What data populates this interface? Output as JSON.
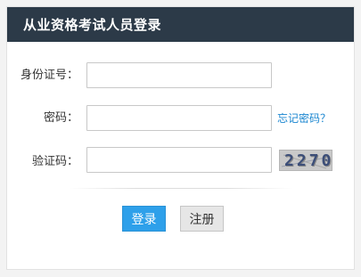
{
  "header": {
    "title": "从业资格考试人员登录"
  },
  "form": {
    "id_label": "身份证号：",
    "id_value": "",
    "password_label": "密码：",
    "password_value": "",
    "captcha_label": "验证码：",
    "captcha_value": "",
    "forgot_password": "忘记密码？",
    "captcha_image_text": "2270"
  },
  "buttons": {
    "login_label": "登录",
    "register_label": "注册"
  },
  "colors": {
    "header_bg": "#2c3a48",
    "login_bg": "#2ea0ea",
    "link": "#1a86d0"
  }
}
